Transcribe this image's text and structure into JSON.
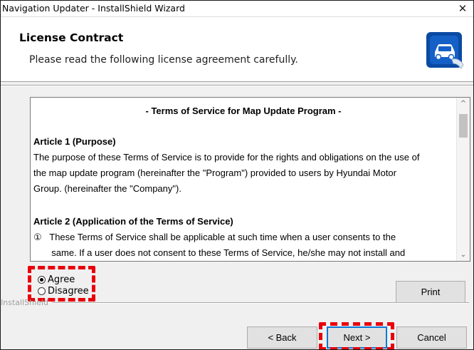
{
  "window": {
    "title": "Navigation Updater - InstallShield Wizard",
    "close_glyph": "✕"
  },
  "header": {
    "title": "License Contract",
    "subtitle": "Please read the following license agreement carefully.",
    "logo_icon": "car-update-icon",
    "accent_color": "#0a4aa3"
  },
  "license": {
    "heading": "- Terms of Service for Map Update Program -",
    "article1_title": "Article 1 (Purpose)",
    "article1_lines": [
      "The purpose of these Terms of Service is to provide for the rights and obligations on the use of",
      "the map update program (hereinafter the \"Program\") provided to users by Hyundai Motor",
      "Group. (hereinafter the \"Company\")."
    ],
    "article2_title": "Article 2 (Application of the Terms of Service)",
    "article2_lines": [
      "①   These Terms of Service shall be applicable at such time when a user consents to the",
      "       same. If a user does not consent to these Terms of Service, he/she may not install and"
    ],
    "scroll_up_glyph": "^",
    "scroll_down_glyph": "⌄"
  },
  "options": {
    "agree_label": "Agree",
    "disagree_label": "Disagree",
    "selected": "agree"
  },
  "brand_text": "InstallShield",
  "buttons": {
    "print": "Print",
    "back": "< Back",
    "next": "Next >",
    "cancel": "Cancel"
  },
  "annotation_color": "#e8000b"
}
